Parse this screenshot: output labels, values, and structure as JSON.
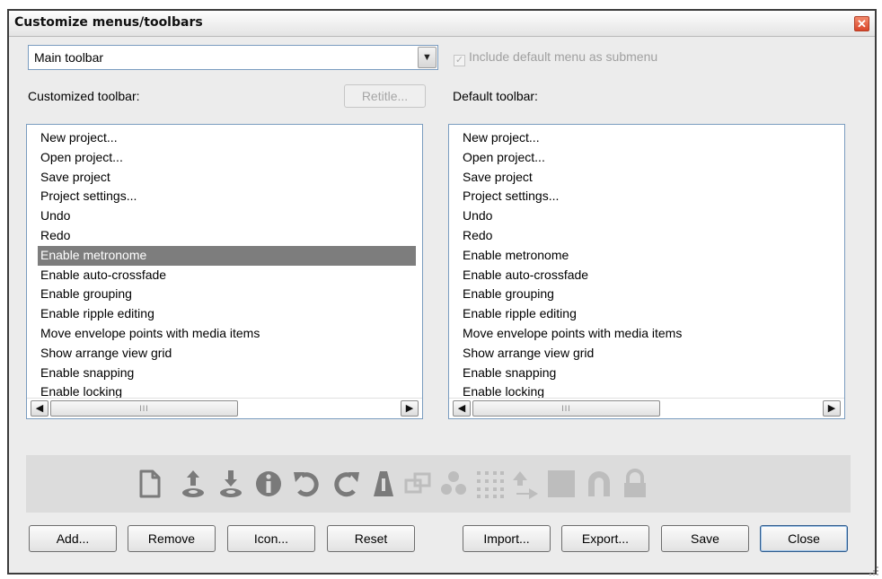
{
  "window": {
    "title": "Customize menus/toolbars"
  },
  "toolbar_select": {
    "value": "Main toolbar"
  },
  "include_default": {
    "label": "Include default menu as submenu",
    "checked": true,
    "enabled": false
  },
  "customized": {
    "label": "Customized toolbar:",
    "retitle_label": "Retitle...",
    "items": [
      "New project...",
      "Open project...",
      "Save project",
      "Project settings...",
      "Undo",
      "Redo",
      "Enable metronome",
      "Enable auto-crossfade",
      "Enable grouping",
      "Enable ripple editing",
      "Move envelope points with media items",
      "Show arrange view grid",
      "Enable snapping",
      "Enable locking"
    ],
    "selected_item": "Enable metronome",
    "scroll_thumb_label": "III"
  },
  "default": {
    "label": "Default toolbar:",
    "items": [
      "New project...",
      "Open project...",
      "Save project",
      "Project settings...",
      "Undo",
      "Redo",
      "Enable metronome",
      "Enable auto-crossfade",
      "Enable grouping",
      "Enable ripple editing",
      "Move envelope points with media items",
      "Show arrange view grid",
      "Enable snapping",
      "Enable locking"
    ],
    "scroll_thumb_label": "III"
  },
  "toolbar_preview_icons": [
    "new-project-icon",
    "open-project-icon",
    "save-project-icon",
    "project-settings-icon",
    "undo-icon",
    "redo-icon",
    "metronome-icon",
    "auto-crossfade-icon",
    "grouping-icon",
    "grid-icon",
    "ripple-editing-icon",
    "snap-icon",
    "snapping-magnet-icon",
    "lock-icon"
  ],
  "buttons": {
    "add": "Add...",
    "remove": "Remove",
    "icon": "Icon...",
    "reset": "Reset",
    "import": "Import...",
    "export": "Export...",
    "save": "Save",
    "close": "Close"
  },
  "colors": {
    "window_bg": "#ececec",
    "selection_bg": "#7d7d7d",
    "icon_active": "#7a7a7a",
    "icon_inactive": "#bdbdbd",
    "close_button": "#d9462a",
    "list_border": "#7a9cbf"
  }
}
